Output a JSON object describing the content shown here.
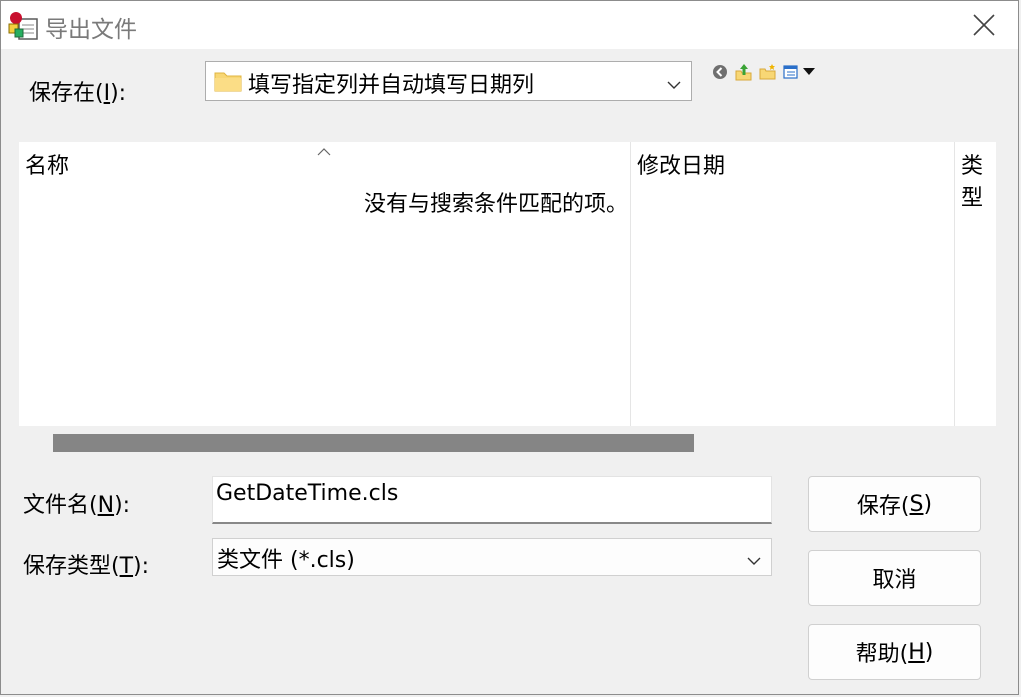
{
  "window": {
    "title": "导出文件",
    "close_icon": "close-icon"
  },
  "lookin": {
    "label_prefix": "保存在(",
    "label_key": "I",
    "label_suffix": "):",
    "value": "填写指定列并自动填写日期列"
  },
  "toolbar": {
    "icons": [
      "back-icon",
      "up-folder-icon",
      "new-folder-icon",
      "view-menu-icon"
    ]
  },
  "filelist": {
    "columns": [
      "名称",
      "修改日期",
      "类型"
    ],
    "empty_message": "没有与搜索条件匹配的项。"
  },
  "filename": {
    "label_prefix": "文件名(",
    "label_key": "N",
    "label_suffix": "):",
    "value": "GetDateTime.cls"
  },
  "filetype": {
    "label_prefix": "保存类型(",
    "label_key": "T",
    "label_suffix": "):",
    "value": "类文件 (*.cls)"
  },
  "buttons": {
    "save_prefix": "保存(",
    "save_key": "S",
    "save_suffix": ")",
    "cancel": "取消",
    "help_prefix": "帮助(",
    "help_key": "H",
    "help_suffix": ")"
  },
  "colors": {
    "folder": "#f8d775",
    "scroll_thumb": "#858585"
  }
}
